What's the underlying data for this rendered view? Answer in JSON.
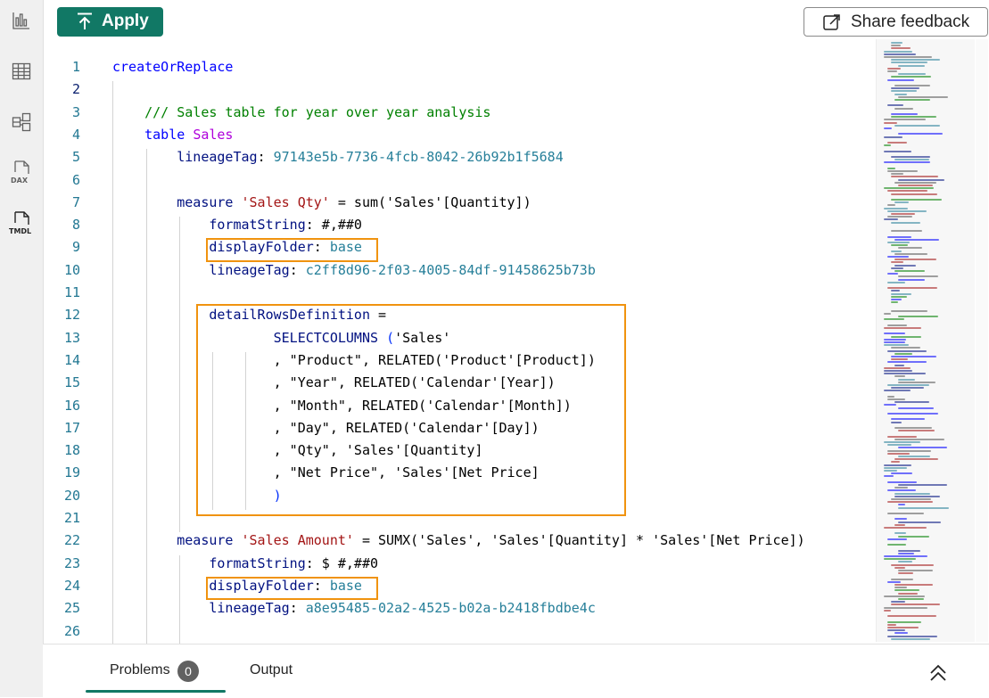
{
  "toolbar": {
    "apply_label": "Apply",
    "share_feedback_label": "Share feedback"
  },
  "view_rail": {
    "items": [
      {
        "name": "report-view",
        "icon": "bar-chart-icon"
      },
      {
        "name": "table-view",
        "icon": "table-grid-icon"
      },
      {
        "name": "model-view",
        "icon": "model-diagram-icon"
      },
      {
        "name": "dax-query-view",
        "icon": "dax-icon",
        "label": "DAX"
      },
      {
        "name": "tmdl-view",
        "icon": "tmdl-icon",
        "label": "TMDL",
        "active": true
      }
    ]
  },
  "editor": {
    "active_line": 2,
    "lines": [
      {
        "n": "1",
        "tokens": [
          {
            "t": "createOrReplace",
            "c": "kw"
          }
        ]
      },
      {
        "n": "2",
        "tokens": []
      },
      {
        "n": "3",
        "tokens": [
          {
            "t": "    ",
            "c": "df"
          },
          {
            "t": "/// Sales table for year over year analysis",
            "c": "cm"
          }
        ]
      },
      {
        "n": "4",
        "tokens": [
          {
            "t": "    ",
            "c": "df"
          },
          {
            "t": "table",
            "c": "kw"
          },
          {
            "t": " ",
            "c": "df"
          },
          {
            "t": "Sales",
            "c": "pu"
          }
        ]
      },
      {
        "n": "5",
        "tokens": [
          {
            "t": "        ",
            "c": "df"
          },
          {
            "t": "lineageTag",
            "c": "pn"
          },
          {
            "t": ": ",
            "c": "df"
          },
          {
            "t": "97143e5b-7736-4fcb-8042-26b92b1f5684",
            "c": "ty"
          }
        ]
      },
      {
        "n": "6",
        "tokens": []
      },
      {
        "n": "7",
        "tokens": [
          {
            "t": "        ",
            "c": "df"
          },
          {
            "t": "measure",
            "c": "pn"
          },
          {
            "t": " ",
            "c": "df"
          },
          {
            "t": "'Sales Qty'",
            "c": "st"
          },
          {
            "t": " = sum('Sales'[Quantity])",
            "c": "df"
          }
        ]
      },
      {
        "n": "8",
        "tokens": [
          {
            "t": "            ",
            "c": "df"
          },
          {
            "t": "formatString",
            "c": "pn"
          },
          {
            "t": ": #,##0",
            "c": "df"
          }
        ]
      },
      {
        "n": "9",
        "tokens": [
          {
            "t": "            ",
            "c": "df"
          },
          {
            "t": "displayFolder",
            "c": "pn"
          },
          {
            "t": ": ",
            "c": "df"
          },
          {
            "t": "base",
            "c": "ty"
          }
        ]
      },
      {
        "n": "10",
        "tokens": [
          {
            "t": "            ",
            "c": "df"
          },
          {
            "t": "lineageTag",
            "c": "pn"
          },
          {
            "t": ": ",
            "c": "df"
          },
          {
            "t": "c2ff8d96-2f03-4005-84df-91458625b73b",
            "c": "ty"
          }
        ]
      },
      {
        "n": "11",
        "tokens": []
      },
      {
        "n": "12",
        "tokens": [
          {
            "t": "            ",
            "c": "df"
          },
          {
            "t": "detailRowsDefinition",
            "c": "pn"
          },
          {
            "t": " =",
            "c": "df"
          }
        ]
      },
      {
        "n": "13",
        "tokens": [
          {
            "t": "                    ",
            "c": "df"
          },
          {
            "t": "SELECTCOLUMNS",
            "c": "pn"
          },
          {
            "t": " ",
            "c": "df"
          },
          {
            "t": "(",
            "c": "bk"
          },
          {
            "t": "'Sales'",
            "c": "df"
          }
        ]
      },
      {
        "n": "14",
        "tokens": [
          {
            "t": "                    , \"Product\", RELATED(",
            "c": "df"
          },
          {
            "t": "'Product'",
            "c": "df"
          },
          {
            "t": "[Product])",
            "c": "df"
          }
        ]
      },
      {
        "n": "15",
        "tokens": [
          {
            "t": "                    , \"Year\", RELATED(",
            "c": "df"
          },
          {
            "t": "'Calendar'",
            "c": "df"
          },
          {
            "t": "[Year])",
            "c": "df"
          }
        ]
      },
      {
        "n": "16",
        "tokens": [
          {
            "t": "                    , \"Month\", RELATED(",
            "c": "df"
          },
          {
            "t": "'Calendar'",
            "c": "df"
          },
          {
            "t": "[Month])",
            "c": "df"
          }
        ]
      },
      {
        "n": "17",
        "tokens": [
          {
            "t": "                    , \"Day\", RELATED(",
            "c": "df"
          },
          {
            "t": "'Calendar'",
            "c": "df"
          },
          {
            "t": "[Day])",
            "c": "df"
          }
        ]
      },
      {
        "n": "18",
        "tokens": [
          {
            "t": "                    , \"Qty\", ",
            "c": "df"
          },
          {
            "t": "'Sales'",
            "c": "df"
          },
          {
            "t": "[Quantity]",
            "c": "df"
          }
        ]
      },
      {
        "n": "19",
        "tokens": [
          {
            "t": "                    , \"Net Price\", ",
            "c": "df"
          },
          {
            "t": "'Sales'",
            "c": "df"
          },
          {
            "t": "[Net Price]",
            "c": "df"
          }
        ]
      },
      {
        "n": "20",
        "tokens": [
          {
            "t": "                    ",
            "c": "df"
          },
          {
            "t": ")",
            "c": "bk"
          }
        ]
      },
      {
        "n": "21",
        "tokens": []
      },
      {
        "n": "22",
        "tokens": [
          {
            "t": "        ",
            "c": "df"
          },
          {
            "t": "measure",
            "c": "pn"
          },
          {
            "t": " ",
            "c": "df"
          },
          {
            "t": "'Sales Amount'",
            "c": "st"
          },
          {
            "t": " = SUMX('Sales', 'Sales'[Quantity] * 'Sales'[Net Price])",
            "c": "df"
          }
        ]
      },
      {
        "n": "23",
        "tokens": [
          {
            "t": "            ",
            "c": "df"
          },
          {
            "t": "formatString",
            "c": "pn"
          },
          {
            "t": ": $ #,##0",
            "c": "df"
          }
        ]
      },
      {
        "n": "24",
        "tokens": [
          {
            "t": "            ",
            "c": "df"
          },
          {
            "t": "displayFolder",
            "c": "pn"
          },
          {
            "t": ": ",
            "c": "df"
          },
          {
            "t": "base",
            "c": "ty"
          }
        ]
      },
      {
        "n": "25",
        "tokens": [
          {
            "t": "            ",
            "c": "df"
          },
          {
            "t": "lineageTag",
            "c": "pn"
          },
          {
            "t": ": ",
            "c": "df"
          },
          {
            "t": "a8e95485-02a2-4525-b02a-b2418fbdbe4c",
            "c": "ty"
          }
        ]
      },
      {
        "n": "26",
        "tokens": []
      }
    ]
  },
  "panel": {
    "problems_label": "Problems",
    "problems_count": "0",
    "output_label": "Output"
  },
  "colors": {
    "accent": "#117865",
    "highlight_border": "#f0930f",
    "line_number": "#237893"
  }
}
